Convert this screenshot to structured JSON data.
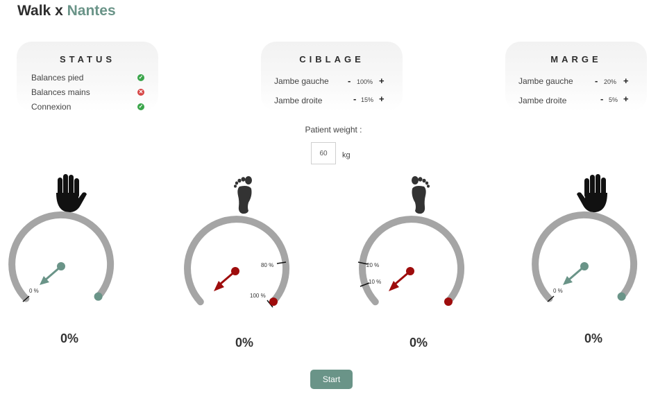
{
  "header": {
    "title_prefix": "Walk x",
    "title_accent": "Nantes"
  },
  "status_card": {
    "title": "STATUS",
    "items": [
      {
        "label": "Balances pied",
        "state": "ok"
      },
      {
        "label": "Balances mains",
        "state": "error"
      },
      {
        "label": "Connexion",
        "state": "ok"
      }
    ]
  },
  "ciblage_card": {
    "title": "CIBLAGE",
    "rows": [
      {
        "label": "Jambe gauche",
        "minus": "-",
        "value": "100%",
        "plus": "+"
      },
      {
        "label": "Jambe droite",
        "minus": "-",
        "value": "15%",
        "plus": "+"
      }
    ]
  },
  "marge_card": {
    "title": "MARGE",
    "rows": [
      {
        "label": "Jambe gauche",
        "minus": "-",
        "value": "20%",
        "plus": "+"
      },
      {
        "label": "Jambe droite",
        "minus": "-",
        "value": "5%",
        "plus": "+"
      }
    ]
  },
  "weight": {
    "label": "Patient weight :",
    "value": "60",
    "unit": "kg"
  },
  "gauges": [
    {
      "icon": "left-hand-icon",
      "percent_text": "0%",
      "labels": [
        "0 %"
      ],
      "needle_color": "#6a9488"
    },
    {
      "icon": "left-foot-icon",
      "percent_text": "0%",
      "labels": [
        "80 %",
        "100 %"
      ],
      "needle_color": "#9e0c0c"
    },
    {
      "icon": "right-foot-icon",
      "percent_text": "0%",
      "labels": [
        "20 %",
        "10 %"
      ],
      "needle_color": "#9e0c0c"
    },
    {
      "icon": "right-hand-icon",
      "percent_text": "0%",
      "labels": [
        "0 %"
      ],
      "needle_color": "#6a9488"
    }
  ],
  "start_button": {
    "label": "Start"
  },
  "colors": {
    "accent": "#6a9488",
    "alert": "#9e0c0c",
    "gauge_track": "#a5a5a5"
  }
}
